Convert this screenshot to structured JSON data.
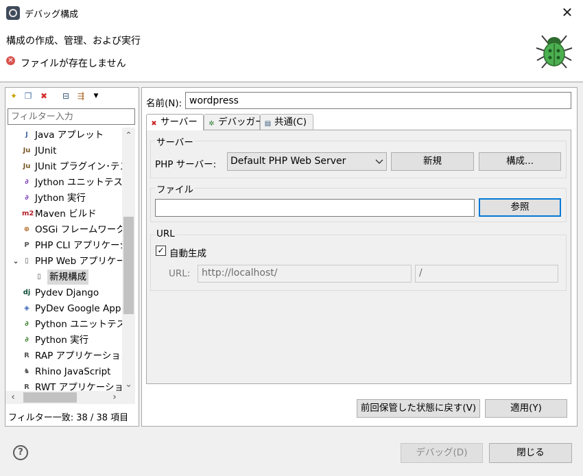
{
  "window": {
    "title": "デバッグ構成",
    "close_glyph": "✕"
  },
  "header": {
    "title": "構成の作成、管理、および実行",
    "error_message": "ファイルが存在しません",
    "error_glyph": "✕",
    "banner_icon": "bug-icon"
  },
  "left": {
    "toolbar": {
      "new_glyph": "✦",
      "duplicate_glyph": "❐",
      "delete_glyph": "✖",
      "collapse_glyph": "⊟",
      "filter_glyph": "⇶",
      "menu_glyph": "▼"
    },
    "filter_placeholder": "フィルター入力",
    "tree": [
      {
        "label": "Java アプレット",
        "icon": "J",
        "color": "#4a6fa5"
      },
      {
        "label": "JUnit",
        "icon": "Ju",
        "color": "#7a5a2a"
      },
      {
        "label": "JUnit プラグイン･テス",
        "icon": "Ju",
        "color": "#7a5a2a"
      },
      {
        "label": "Jython ユニットテスト",
        "icon": "∂",
        "color": "#7b3fb5"
      },
      {
        "label": "Jython 実行",
        "icon": "∂",
        "color": "#7b3fb5"
      },
      {
        "label": "Maven ビルド",
        "icon": "m2",
        "color": "#b3202a"
      },
      {
        "label": "OSGi フレームワーク",
        "icon": "⊕",
        "color": "#b06a2a"
      },
      {
        "label": "PHP CLI アプリケーシ",
        "icon": "P",
        "color": "#555"
      },
      {
        "label": "PHP Web アプリケー",
        "icon": "▯",
        "color": "#555",
        "expander": "⌄"
      },
      {
        "label": "新規構成",
        "icon": "▯",
        "color": "#555",
        "child": true,
        "selected": true
      },
      {
        "label": "Pydev Django",
        "icon": "dj",
        "color": "#0c4b33"
      },
      {
        "label": "PyDev Google App",
        "icon": "◈",
        "color": "#3b6bb5"
      },
      {
        "label": "Python ユニットテスト",
        "icon": "∂",
        "color": "#3a7d2a"
      },
      {
        "label": "Python 実行",
        "icon": "∂",
        "color": "#3a7d2a"
      },
      {
        "label": "RAP アプリケーション",
        "icon": "R",
        "color": "#555"
      },
      {
        "label": "Rhino JavaScript",
        "icon": "♞",
        "color": "#555"
      },
      {
        "label": "RWT アプリケーション",
        "icon": "R",
        "color": "#555"
      }
    ],
    "scroll_up_glyph": "⌃",
    "scroll_down_glyph": "⌄",
    "scroll_left_glyph": "‹",
    "scroll_right_glyph": "›",
    "match_text": "フィルター一致: 38 / 38 項目"
  },
  "right": {
    "name_label": "名前(N):",
    "name_value": "wordpress",
    "tabs": [
      {
        "label": "サーバー",
        "icon": "✖",
        "icon_color": "#c62828"
      },
      {
        "label": "デバッガー",
        "icon": "✲",
        "icon_color": "#2e7d32"
      },
      {
        "label": "共通(C)",
        "icon": "▤",
        "icon_color": "#35587a"
      }
    ],
    "server_group": {
      "title": "サーバー",
      "php_server_label": "PHP サーバー:",
      "selected_server": "Default PHP Web Server",
      "new_button": "新規",
      "configure_button": "構成..."
    },
    "file_group": {
      "title": "ファイル",
      "file_value": "",
      "browse_button": "参照"
    },
    "url_group": {
      "title": "URL",
      "autogen_label": "自動生成",
      "autogen_checked": "✓",
      "url_label": "URL:",
      "url_value": "http://localhost/",
      "path_value": "/"
    },
    "revert_button": "前回保管した状態に戻す(V)",
    "apply_button": "適用(Y)"
  },
  "footer": {
    "help_glyph": "?",
    "debug_button": "デバッグ(D)",
    "close_button": "閉じる"
  }
}
